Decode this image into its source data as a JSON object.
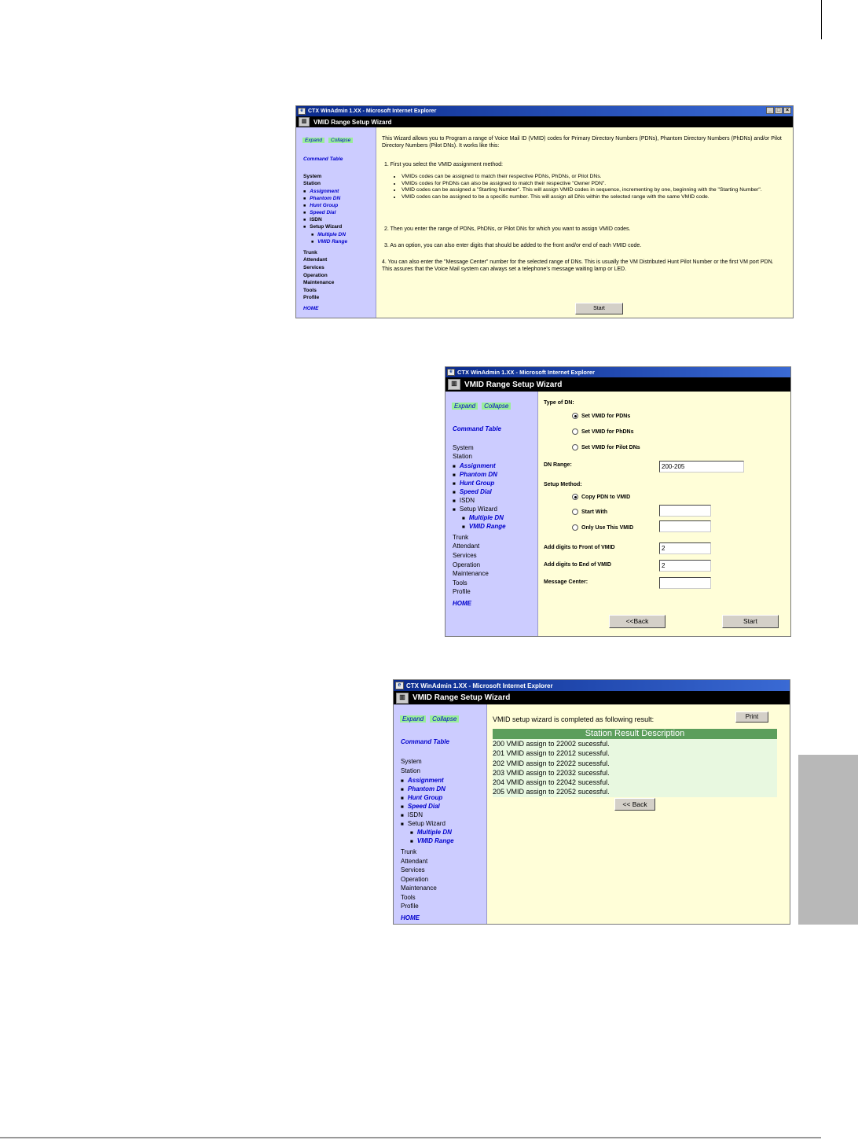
{
  "app_title": "CTX WinAdmin 1.XX - Microsoft Internet Explorer",
  "wizard_title": "VMID Range Setup Wizard",
  "nav": {
    "expand": "Expand",
    "collapse": "Collapse",
    "command_table": "Command Table",
    "system": "System",
    "station": "Station",
    "station_items": [
      "Assignment",
      "Phantom DN",
      "Hunt Group",
      "Speed Dial"
    ],
    "isdn": "ISDN",
    "setup_wizard": "Setup Wizard",
    "wizard_items": [
      "Multiple DN",
      "VMID Range"
    ],
    "trunk": "Trunk",
    "attendant": "Attendant",
    "services": "Services",
    "operation": "Operation",
    "maintenance": "Maintenance",
    "tools": "Tools",
    "profile": "Profile",
    "home": "HOME"
  },
  "screen1": {
    "intro": "This Wizard allows you to Program a range of Voice Mail ID (VMID) codes for Primary Directory Numbers (PDNs), Phantom Directory Numbers (PhDNs) and/or Pilot Directory Numbers (Pilot DNs). It works like this:",
    "step1": "1. First you select the VMID assignment method:",
    "bullets": [
      "VMIDs codes can be assigned to match their respective PDNs, PhDNs, or Pilot DNs.",
      "VMIDs codes for PhDNs can also be assigned to match their respective \"Owner PDN\".",
      "VMID codes can be assigned a \"Starting Number\". This will assign VMID codes in sequence, incrementing by one, beginning with the \"Starting Number\".",
      "VMID codes can be assigned to be a specific number. This will assign all DNs within the selected range with the same VMID code."
    ],
    "step2": "2. Then you enter the range of PDNs, PhDNs, or Pilot DNs for which you want to assign VMID codes.",
    "step3": "3. As an option, you can also enter digits that should be added to the front and/or end of each VMID code.",
    "step4": "4. You can also enter the \"Message Center\" number for the selected range of DNs. This is usually the VM Distributed Hunt Pilot Number or the first VM port PDN.  This assures that the Voice Mail system can always set a telephone's message waiting lamp or LED.",
    "start_button": "Start"
  },
  "screen2": {
    "type_of_dn_label": "Type of DN:",
    "radio_pdns": "Set VMID for PDNs",
    "radio_phdns": "Set VMID for PhDNs",
    "radio_pilot": "Set VMID for Pilot DNs",
    "dn_range_label": "DN Range:",
    "dn_range_value": "200-205",
    "setup_method_label": "Setup Method:",
    "radio_copy": "Copy PDN to VMID",
    "radio_start_with": "Start With",
    "radio_only_use": "Only Use This VMID",
    "front_label": "Add digits to Front of VMID",
    "front_value": "2",
    "end_label": "Add digits to End of VMID",
    "end_value": "2",
    "message_center_label": "Message Center:",
    "back_button": "<<Back",
    "start_button": "Start"
  },
  "screen3": {
    "completed_text": "VMID setup wizard is completed as following result:",
    "print_button": "Print",
    "table_header": "Station Result Description",
    "rows": [
      "200 VMID assign to 22002 sucessful.",
      "201 VMID assign to 22012 sucessful.",
      "202 VMID assign to 22022 sucessful.",
      "203 VMID assign to 22032 sucessful.",
      "204 VMID assign to 22042 sucessful.",
      "205 VMID assign to 22052 sucessful."
    ],
    "back_button": "<< Back"
  },
  "colors": {
    "title_bar": "#0a2a8c",
    "nav_bg": "#ccccff",
    "content_bg": "#fffed8",
    "pill_bg": "#99ee99",
    "table_header_bg": "#5c9e5c",
    "table_row_bg": "#e8f8e0",
    "link": "#0000cc"
  }
}
